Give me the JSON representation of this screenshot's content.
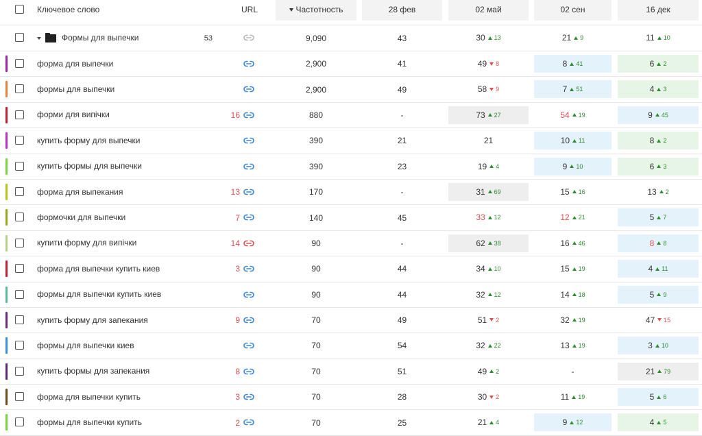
{
  "header": {
    "keyword": "Ключевое слово",
    "url": "URL",
    "frequency": "Частотность",
    "dates": [
      "28 фев",
      "02 май",
      "02 сен",
      "16 дек"
    ]
  },
  "group": {
    "name": "Формы для выпечки",
    "count": "53",
    "frequency": "9,090",
    "c28": "43",
    "pos": [
      {
        "v": "30",
        "d": "13",
        "dir": "up"
      },
      {
        "v": "21",
        "d": "9",
        "dir": "up"
      },
      {
        "v": "11",
        "d": "10",
        "dir": "up"
      }
    ]
  },
  "colors": {
    "link_blue": "#3b86d6",
    "link_red": "#e04f4f",
    "up": "#2e8b2e",
    "down": "#e04f4f"
  },
  "rows": [
    {
      "kw": "форма для выпечки",
      "bar": "#a020a8",
      "urlcount": "",
      "link": "blue",
      "freq": "2,900",
      "c28": "41",
      "pos": [
        {
          "v": "49",
          "d": "8",
          "dir": "down",
          "bg": ""
        },
        {
          "v": "8",
          "d": "41",
          "dir": "up",
          "bg": "blue"
        },
        {
          "v": "6",
          "d": "2",
          "dir": "up",
          "bg": "green"
        }
      ]
    },
    {
      "kw": "формы для выпечки",
      "bar": "#e8803a",
      "urlcount": "",
      "link": "blue",
      "freq": "2,900",
      "c28": "49",
      "pos": [
        {
          "v": "58",
          "d": "9",
          "dir": "down",
          "bg": ""
        },
        {
          "v": "7",
          "d": "51",
          "dir": "up",
          "bg": "blue"
        },
        {
          "v": "4",
          "d": "3",
          "dir": "up",
          "bg": "green"
        }
      ]
    },
    {
      "kw": "форми для випічки",
      "bar": "#c0212e",
      "urlcount": "16",
      "link": "blue",
      "freq": "880",
      "c28": "-",
      "pos": [
        {
          "v": "73",
          "d": "27",
          "dir": "up",
          "bg": "gray"
        },
        {
          "v": "54",
          "d": "19",
          "dir": "up",
          "bg": "",
          "red": true
        },
        {
          "v": "9",
          "d": "45",
          "dir": "up",
          "bg": "blue"
        }
      ]
    },
    {
      "kw": "купить форму для выпечки",
      "bar": "#b830c8",
      "urlcount": "",
      "link": "blue",
      "freq": "390",
      "c28": "21",
      "pos": [
        {
          "v": "21",
          "d": "",
          "dir": "",
          "bg": ""
        },
        {
          "v": "10",
          "d": "11",
          "dir": "up",
          "bg": "blue"
        },
        {
          "v": "8",
          "d": "2",
          "dir": "up",
          "bg": "green"
        }
      ]
    },
    {
      "kw": "купить формы для выпечки",
      "bar": "#7ad33a",
      "urlcount": "",
      "link": "blue",
      "freq": "390",
      "c28": "23",
      "pos": [
        {
          "v": "19",
          "d": "4",
          "dir": "up",
          "bg": ""
        },
        {
          "v": "9",
          "d": "10",
          "dir": "up",
          "bg": "blue"
        },
        {
          "v": "6",
          "d": "3",
          "dir": "up",
          "bg": "green"
        }
      ]
    },
    {
      "kw": "форма для выпекания",
      "bar": "#b8c21a",
      "urlcount": "13",
      "link": "blue",
      "freq": "170",
      "c28": "-",
      "pos": [
        {
          "v": "31",
          "d": "69",
          "dir": "up",
          "bg": "gray"
        },
        {
          "v": "15",
          "d": "16",
          "dir": "up",
          "bg": ""
        },
        {
          "v": "13",
          "d": "2",
          "dir": "up",
          "bg": ""
        }
      ]
    },
    {
      "kw": "формочки для выпечки",
      "bar": "#9aa818",
      "urlcount": "7",
      "link": "blue",
      "freq": "140",
      "c28": "45",
      "pos": [
        {
          "v": "33",
          "d": "12",
          "dir": "up",
          "bg": "",
          "red": true
        },
        {
          "v": "12",
          "d": "21",
          "dir": "up",
          "bg": "",
          "red": true
        },
        {
          "v": "5",
          "d": "7",
          "dir": "up",
          "bg": "blue"
        }
      ]
    },
    {
      "kw": "купити форму для випічки",
      "bar": "#b5d08a",
      "urlcount": "14",
      "link": "red",
      "freq": "90",
      "c28": "-",
      "pos": [
        {
          "v": "62",
          "d": "38",
          "dir": "up",
          "bg": "gray"
        },
        {
          "v": "16",
          "d": "46",
          "dir": "up",
          "bg": ""
        },
        {
          "v": "8",
          "d": "8",
          "dir": "up",
          "bg": "blue",
          "red": true
        }
      ]
    },
    {
      "kw": "форма для выпечки купить киев",
      "bar": "#c0212e",
      "urlcount": "3",
      "link": "blue",
      "freq": "90",
      "c28": "44",
      "pos": [
        {
          "v": "34",
          "d": "10",
          "dir": "up",
          "bg": ""
        },
        {
          "v": "15",
          "d": "19",
          "dir": "up",
          "bg": ""
        },
        {
          "v": "4",
          "d": "11",
          "dir": "up",
          "bg": "blue"
        }
      ]
    },
    {
      "kw": "формы для выпечки купить киев",
      "bar": "#5cb89a",
      "urlcount": "",
      "link": "blue",
      "freq": "90",
      "c28": "44",
      "pos": [
        {
          "v": "32",
          "d": "12",
          "dir": "up",
          "bg": ""
        },
        {
          "v": "14",
          "d": "18",
          "dir": "up",
          "bg": ""
        },
        {
          "v": "5",
          "d": "9",
          "dir": "up",
          "bg": "blue"
        }
      ]
    },
    {
      "kw": "купить форму для запекания",
      "bar": "#6a2a7a",
      "urlcount": "9",
      "link": "blue",
      "freq": "70",
      "c28": "49",
      "pos": [
        {
          "v": "51",
          "d": "2",
          "dir": "down",
          "bg": ""
        },
        {
          "v": "32",
          "d": "19",
          "dir": "up",
          "bg": ""
        },
        {
          "v": "47",
          "d": "15",
          "dir": "down",
          "bg": ""
        }
      ]
    },
    {
      "kw": "формы для выпечки киев",
      "bar": "#3a8fd8",
      "urlcount": "",
      "link": "blue",
      "freq": "70",
      "c28": "54",
      "pos": [
        {
          "v": "32",
          "d": "22",
          "dir": "up",
          "bg": ""
        },
        {
          "v": "13",
          "d": "19",
          "dir": "up",
          "bg": ""
        },
        {
          "v": "3",
          "d": "10",
          "dir": "up",
          "bg": "blue"
        }
      ]
    },
    {
      "kw": "купить формы для запекания",
      "bar": "#5a2a78",
      "urlcount": "8",
      "link": "blue",
      "freq": "70",
      "c28": "51",
      "pos": [
        {
          "v": "49",
          "d": "2",
          "dir": "up",
          "bg": ""
        },
        {
          "v": "-",
          "d": "",
          "dir": "",
          "bg": ""
        },
        {
          "v": "21",
          "d": "79",
          "dir": "up",
          "bg": "gray"
        }
      ]
    },
    {
      "kw": "форма для выпечки купить",
      "bar": "#6a4a1a",
      "urlcount": "3",
      "link": "blue",
      "freq": "70",
      "c28": "28",
      "pos": [
        {
          "v": "30",
          "d": "2",
          "dir": "down",
          "bg": ""
        },
        {
          "v": "11",
          "d": "19",
          "dir": "up",
          "bg": ""
        },
        {
          "v": "5",
          "d": "6",
          "dir": "up",
          "bg": "blue"
        }
      ]
    },
    {
      "kw": "формы для выпечки купить",
      "bar": "#7ad33a",
      "urlcount": "2",
      "link": "blue",
      "freq": "70",
      "c28": "25",
      "pos": [
        {
          "v": "21",
          "d": "4",
          "dir": "up",
          "bg": ""
        },
        {
          "v": "9",
          "d": "12",
          "dir": "up",
          "bg": "blue"
        },
        {
          "v": "4",
          "d": "5",
          "dir": "up",
          "bg": "green"
        }
      ]
    }
  ]
}
